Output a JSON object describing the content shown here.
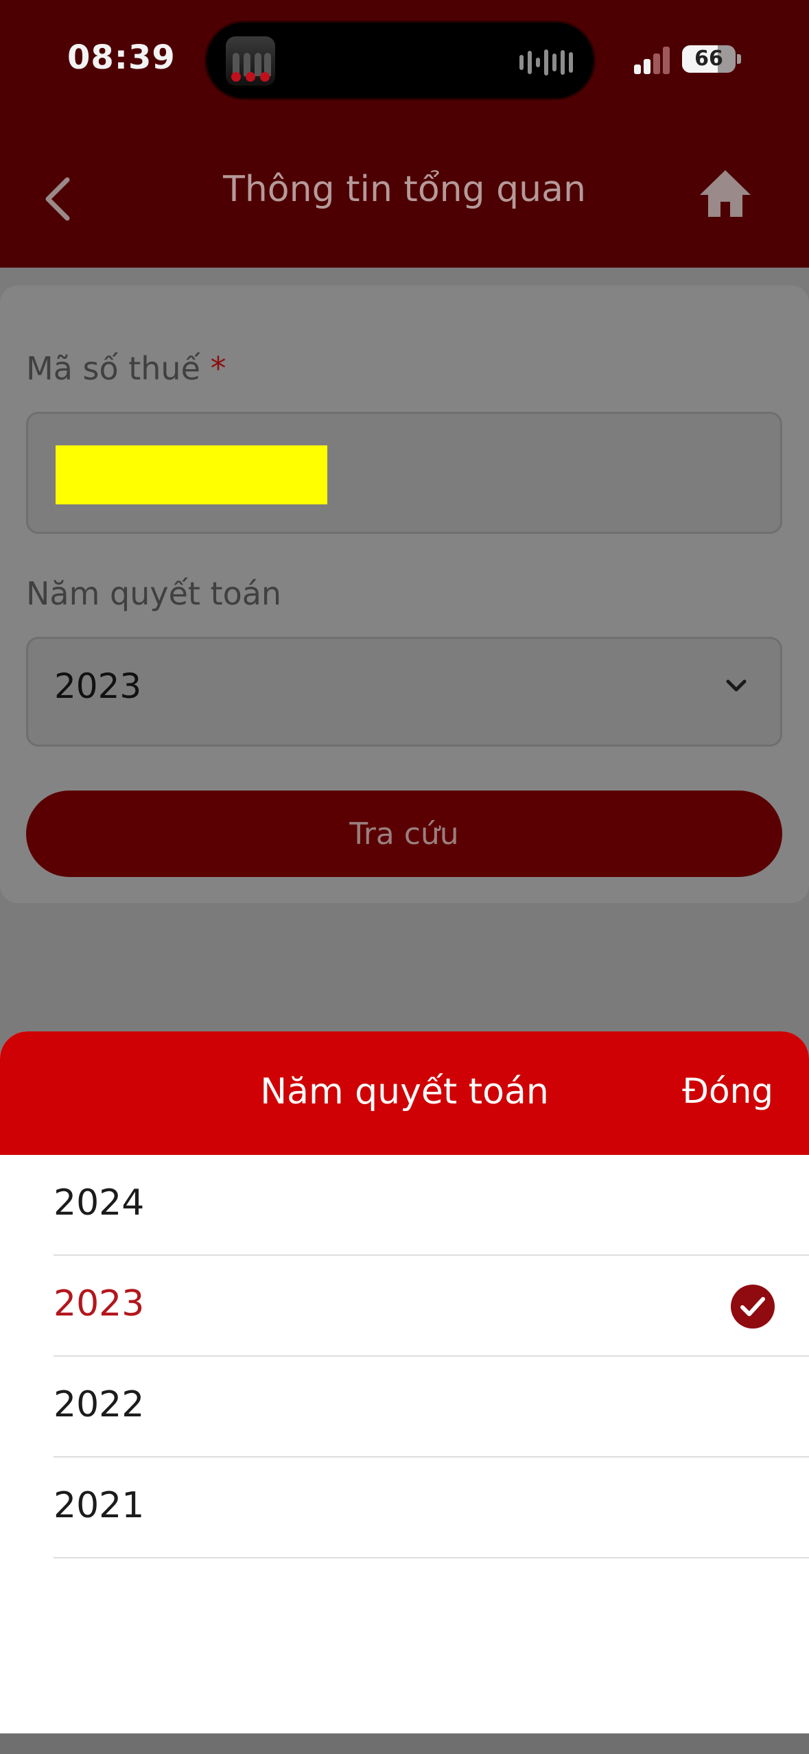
{
  "status_bar": {
    "time": "08:39",
    "battery": "66"
  },
  "nav": {
    "title": "Thông tin tổng quan",
    "back_icon": "chevron-left-icon",
    "home_icon": "home-icon"
  },
  "form": {
    "tax_code": {
      "label": "Mã số thuế",
      "required_mark": "*"
    },
    "year": {
      "label": "Năm quyết toán",
      "value": "2023"
    },
    "search_label": "Tra cứu"
  },
  "sheet": {
    "title": "Năm quyết toán",
    "close_label": "Đóng",
    "options": [
      {
        "label": "2024",
        "selected": false
      },
      {
        "label": "2023",
        "selected": true
      },
      {
        "label": "2022",
        "selected": false
      },
      {
        "label": "2021",
        "selected": false
      }
    ]
  },
  "colors": {
    "header_dark": "#4d0002",
    "sheet_header": "#cf0104",
    "selected_text": "#b3161c",
    "check": "#8f0b10",
    "redaction": "#ffff00"
  }
}
